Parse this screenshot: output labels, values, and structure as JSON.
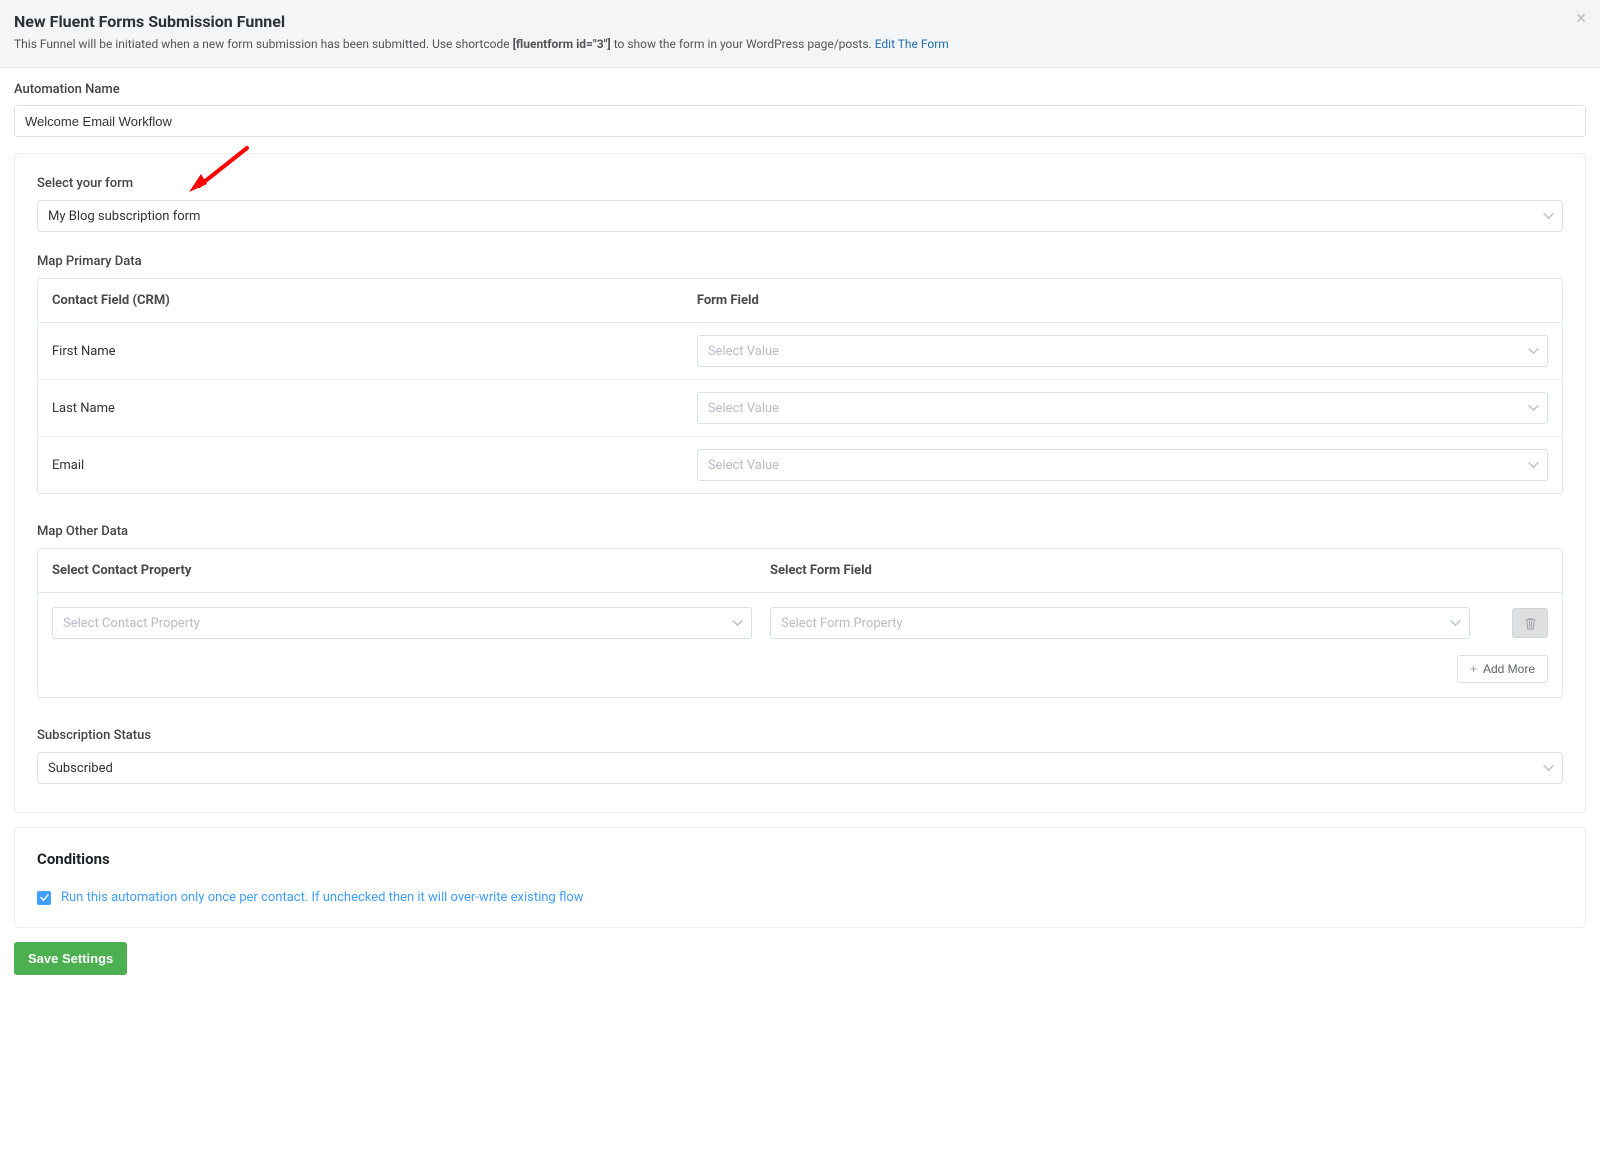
{
  "header": {
    "title": "New Fluent Forms Submission Funnel",
    "subtitle_pre": "This Funnel will be initiated when a new form submission has been submitted. Use shortcode ",
    "shortcode": "[fluentform id=\"3\"]",
    "subtitle_mid": " to show the form in your WordPress page/posts. ",
    "edit_link": "Edit The Form"
  },
  "automation_name": {
    "label": "Automation Name",
    "value": "Welcome Email Workflow"
  },
  "form": {
    "label": "Select your form",
    "value": "My Blog subscription form"
  },
  "primary": {
    "label": "Map Primary Data",
    "col_contact": "Contact Field (CRM)",
    "col_form": "Form Field",
    "rows": [
      {
        "field": "First Name",
        "placeholder": "Select Value"
      },
      {
        "field": "Last Name",
        "placeholder": "Select Value"
      },
      {
        "field": "Email",
        "placeholder": "Select Value"
      }
    ]
  },
  "other": {
    "label": "Map Other Data",
    "col_prop": "Select Contact Property",
    "col_field": "Select Form Field",
    "row": {
      "prop_placeholder": "Select Contact Property",
      "field_placeholder": "Select Form Property"
    },
    "add_more": "Add More"
  },
  "subscription": {
    "label": "Subscription Status",
    "value": "Subscribed"
  },
  "conditions": {
    "title": "Conditions",
    "run_once": "Run this automation only once per contact. If unchecked then it will over-write existing flow"
  },
  "save": "Save Settings"
}
